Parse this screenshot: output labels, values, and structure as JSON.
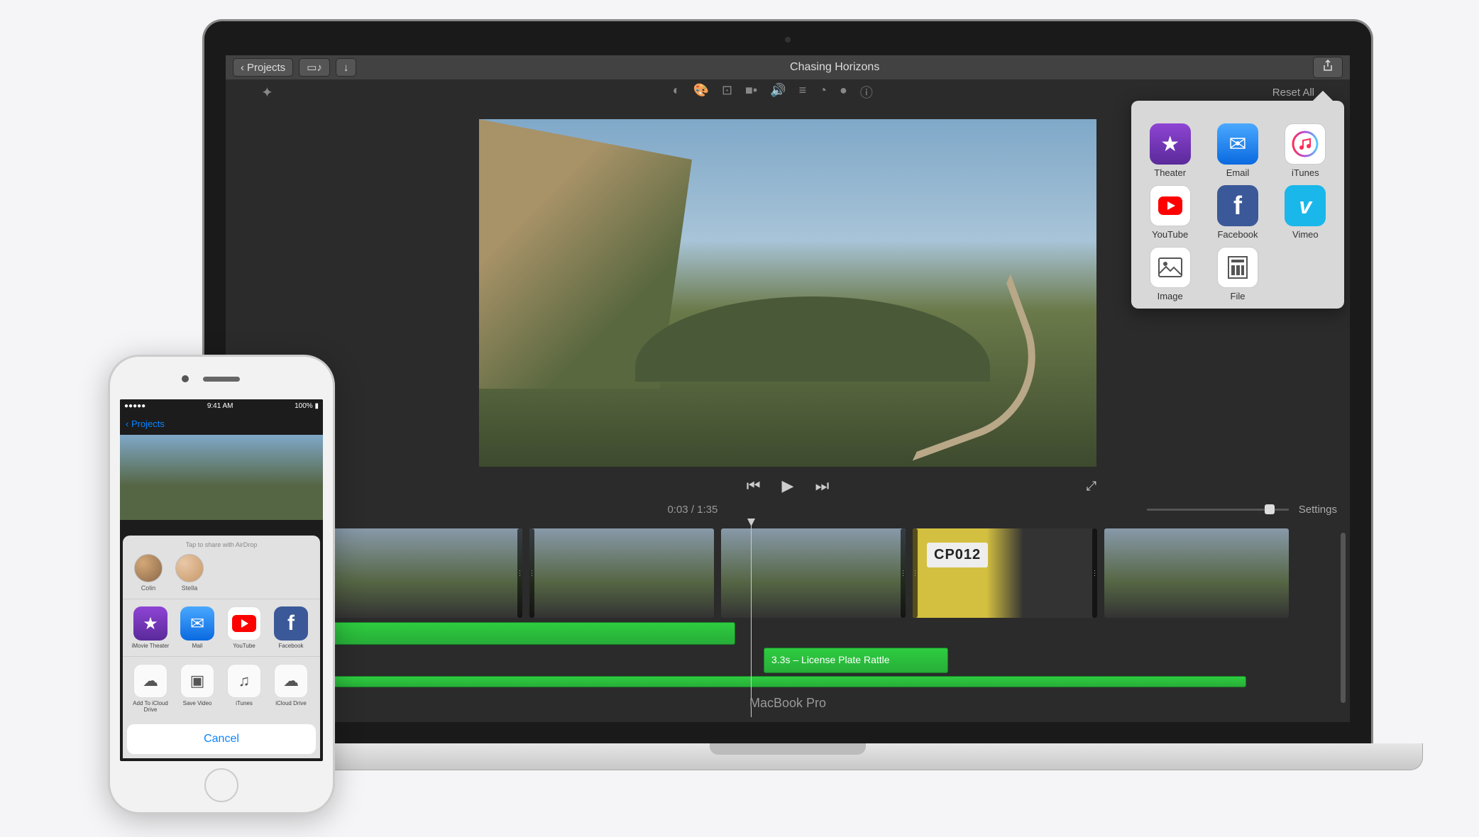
{
  "mac": {
    "device_label": "MacBook Pro",
    "titlebar": {
      "back_label": "Projects",
      "project_title": "Chasing Horizons"
    },
    "toolbar": {
      "reset_label": "Reset All"
    },
    "playback": {
      "current": "0:03",
      "total": "1:35",
      "settings_label": "Settings"
    },
    "timeline": {
      "audio_clip_label": "3.3s – License Plate Rattle",
      "plate_text": "CP012"
    },
    "share_popover": [
      {
        "label": "Theater",
        "icon": "theater"
      },
      {
        "label": "Email",
        "icon": "email"
      },
      {
        "label": "iTunes",
        "icon": "itunes"
      },
      {
        "label": "YouTube",
        "icon": "youtube"
      },
      {
        "label": "Facebook",
        "icon": "facebook"
      },
      {
        "label": "Vimeo",
        "icon": "vimeo"
      },
      {
        "label": "Image",
        "icon": "image"
      },
      {
        "label": "File",
        "icon": "file"
      }
    ]
  },
  "phone": {
    "status": {
      "time": "9:41 AM",
      "battery": "100%",
      "carrier": "●●●●●"
    },
    "nav": {
      "back_label": "Projects"
    },
    "share": {
      "airdrop_hint": "Tap to share with AirDrop",
      "people": [
        {
          "name": "Colin"
        },
        {
          "name": "Stella"
        }
      ],
      "apps": [
        {
          "label": "iMovie Theater",
          "icon": "imovie"
        },
        {
          "label": "Mail",
          "icon": "mail"
        },
        {
          "label": "YouTube",
          "icon": "youtube"
        },
        {
          "label": "Facebook",
          "icon": "facebook"
        }
      ],
      "actions": [
        {
          "label": "Add To iCloud Drive",
          "icon": "cloud-add"
        },
        {
          "label": "Save Video",
          "icon": "save"
        },
        {
          "label": "iTunes",
          "icon": "itunes"
        },
        {
          "label": "iCloud Drive",
          "icon": "cloud"
        }
      ],
      "cancel_label": "Cancel"
    }
  }
}
